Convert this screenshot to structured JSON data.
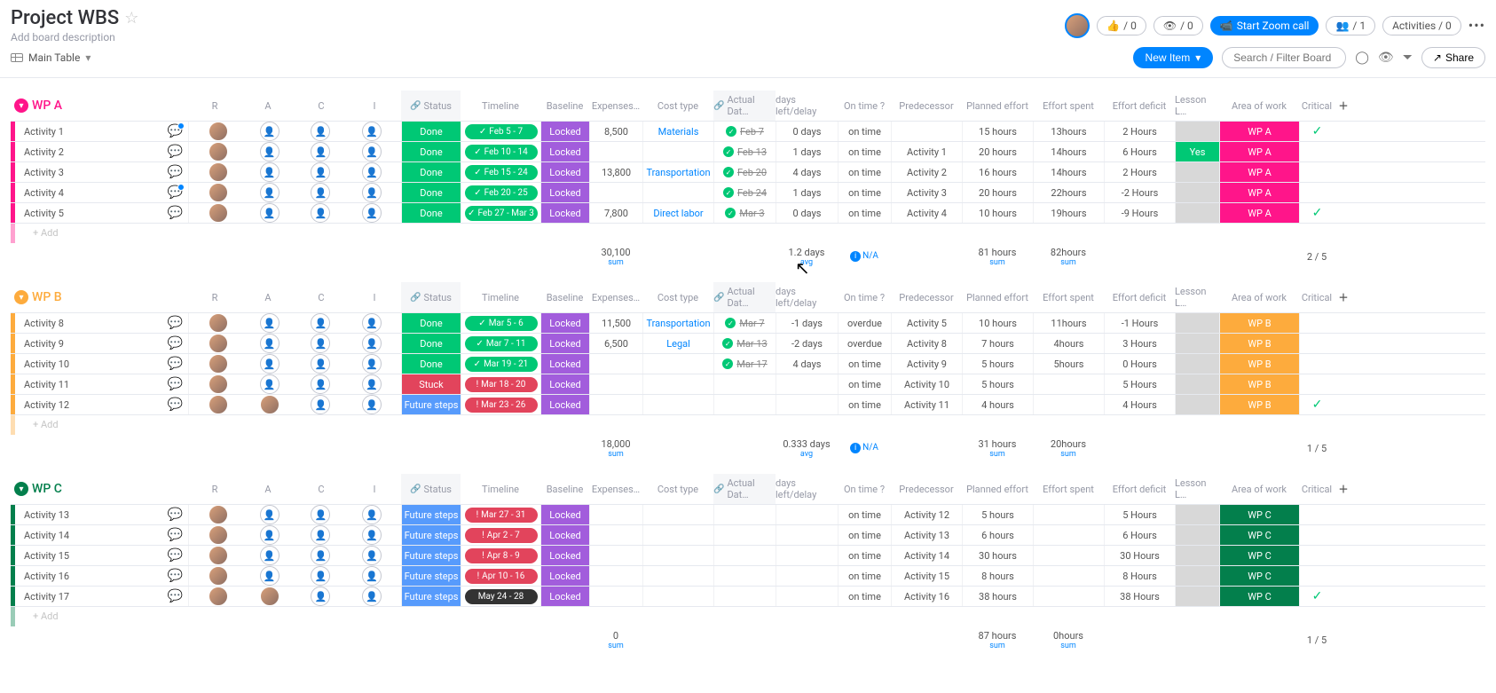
{
  "header": {
    "title": "Project WBS",
    "subtitle": "Add board description",
    "view_label": "Main Table",
    "like_count": "/ 0",
    "view_count": "/ 0",
    "zoom_label": "Start Zoom call",
    "people_count": "/ 1",
    "activities_label": "Activities / 0",
    "new_item_label": "New Item",
    "search_placeholder": "Search / Filter Board",
    "share_label": "Share"
  },
  "columns": {
    "r": "R",
    "a": "A",
    "c": "C",
    "i": "I",
    "status": "Status",
    "timeline": "Timeline",
    "baseline": "Baseline",
    "expenses": "Expenses…",
    "cost_type": "Cost type",
    "actual_date": "Actual Dat…",
    "days_left": "days left/delay",
    "on_time": "On time ?",
    "predecessor": "Predecessor",
    "planned_effort": "Planned effort",
    "effort_spent": "Effort spent",
    "effort_deficit": "Effort deficit",
    "lesson": "Lesson L…",
    "area": "Area of work",
    "critical": "Critical"
  },
  "groups": [
    {
      "id": "wpa",
      "title": "WP A",
      "color": "#ff158a",
      "rows": [
        {
          "name": "Activity 1",
          "chat": "active",
          "people": [
            true,
            false,
            false,
            false
          ],
          "status": "Done",
          "status_cls": "done",
          "timeline": "Feb 5 - 7",
          "tl_cls": "done",
          "tl_sym": "✓",
          "baseline": "Locked",
          "expenses": "8,500",
          "cost_type": "Materials",
          "actual": "Feb 7",
          "actual_done": true,
          "days": "0 days",
          "ontime": "on time",
          "pred": "",
          "planned": "15 hours",
          "spent": "13hours",
          "deficit": "2 Hours",
          "lesson": "",
          "lesson_bg": "grey",
          "area": "WP A",
          "area_bg": "pink",
          "critical": true
        },
        {
          "name": "Activity 2",
          "chat": "",
          "people": [
            true,
            false,
            false,
            false
          ],
          "status": "Done",
          "status_cls": "done",
          "timeline": "Feb 10 - 14",
          "tl_cls": "done",
          "tl_sym": "✓",
          "baseline": "Locked",
          "expenses": "",
          "cost_type": "",
          "actual": "Feb 13",
          "actual_done": true,
          "days": "1 days",
          "ontime": "on time",
          "pred": "Activity 1",
          "planned": "20 hours",
          "spent": "14hours",
          "deficit": "6 Hours",
          "lesson": "Yes",
          "lesson_bg": "green",
          "area": "WP A",
          "area_bg": "pink",
          "critical": false
        },
        {
          "name": "Activity 3",
          "chat": "",
          "people": [
            true,
            false,
            false,
            false
          ],
          "status": "Done",
          "status_cls": "done",
          "timeline": "Feb 15 - 24",
          "tl_cls": "done",
          "tl_sym": "✓",
          "baseline": "Locked",
          "expenses": "13,800",
          "cost_type": "Transportation",
          "actual": "Feb 20",
          "actual_done": true,
          "days": "4 days",
          "ontime": "on time",
          "pred": "Activity 2",
          "planned": "16 hours",
          "spent": "14hours",
          "deficit": "2 Hours",
          "lesson": "",
          "lesson_bg": "grey",
          "area": "WP A",
          "area_bg": "pink",
          "critical": false
        },
        {
          "name": "Activity 4",
          "chat": "active",
          "people": [
            true,
            false,
            false,
            false
          ],
          "status": "Done",
          "status_cls": "done",
          "timeline": "Feb 20 - 25",
          "tl_cls": "done",
          "tl_sym": "✓",
          "baseline": "Locked",
          "expenses": "",
          "cost_type": "",
          "actual": "Feb 24",
          "actual_done": true,
          "days": "1 days",
          "ontime": "on time",
          "pred": "Activity 3",
          "planned": "20 hours",
          "spent": "22hours",
          "deficit": "-2 Hours",
          "lesson": "",
          "lesson_bg": "grey",
          "area": "WP A",
          "area_bg": "pink",
          "critical": false
        },
        {
          "name": "Activity 5",
          "chat": "",
          "people": [
            true,
            false,
            false,
            false
          ],
          "status": "Done",
          "status_cls": "done",
          "timeline": "Feb 27 - Mar 3",
          "tl_cls": "done",
          "tl_sym": "✓",
          "baseline": "Locked",
          "expenses": "7,800",
          "cost_type": "Direct labor",
          "actual": "Mar 3",
          "actual_done": true,
          "days": "0 days",
          "ontime": "on time",
          "pred": "Activity 4",
          "planned": "10 hours",
          "spent": "19hours",
          "deficit": "-9 Hours",
          "lesson": "",
          "lesson_bg": "grey",
          "area": "WP A",
          "area_bg": "pink",
          "critical": true
        }
      ],
      "footer": {
        "expenses_sum": "30,100",
        "days_avg": "1.2 days",
        "ontime": "N/A",
        "planned": "81 hours",
        "spent": "82hours",
        "critical": "2 / 5"
      }
    },
    {
      "id": "wpb",
      "title": "WP B",
      "color": "#fdab3d",
      "rows": [
        {
          "name": "Activity 8",
          "chat": "",
          "people": [
            true,
            false,
            false,
            false
          ],
          "status": "Done",
          "status_cls": "done",
          "timeline": "Mar 5 - 6",
          "tl_cls": "done",
          "tl_sym": "✓",
          "baseline": "Locked",
          "expenses": "11,500",
          "cost_type": "Transportation",
          "actual": "Mar 7",
          "actual_done": true,
          "days": "-1 days",
          "ontime": "overdue",
          "pred": "Activity 5",
          "planned": "10 hours",
          "spent": "11hours",
          "deficit": "-1 Hours",
          "lesson": "",
          "lesson_bg": "grey",
          "area": "WP B",
          "area_bg": "amber",
          "critical": false
        },
        {
          "name": "Activity 9",
          "chat": "",
          "people": [
            true,
            false,
            false,
            false
          ],
          "status": "Done",
          "status_cls": "done",
          "timeline": "Mar 7 - 11",
          "tl_cls": "done",
          "tl_sym": "✓",
          "baseline": "Locked",
          "expenses": "6,500",
          "cost_type": "Legal",
          "actual": "Mar 13",
          "actual_done": true,
          "days": "-2 days",
          "ontime": "overdue",
          "pred": "Activity 8",
          "planned": "7 hours",
          "spent": "4hours",
          "deficit": "3 Hours",
          "lesson": "",
          "lesson_bg": "grey",
          "area": "WP B",
          "area_bg": "amber",
          "critical": false
        },
        {
          "name": "Activity 10",
          "chat": "",
          "people": [
            true,
            false,
            false,
            false
          ],
          "status": "Done",
          "status_cls": "done",
          "timeline": "Mar 19 - 21",
          "tl_cls": "done",
          "tl_sym": "✓",
          "baseline": "Locked",
          "expenses": "",
          "cost_type": "",
          "actual": "Mar 17",
          "actual_done": true,
          "days": "4 days",
          "ontime": "on time",
          "pred": "Activity 9",
          "planned": "5 hours",
          "spent": "5hours",
          "deficit": "0 Hours",
          "lesson": "",
          "lesson_bg": "grey",
          "area": "WP B",
          "area_bg": "amber",
          "critical": false
        },
        {
          "name": "Activity 11",
          "chat": "",
          "people": [
            true,
            false,
            false,
            false
          ],
          "status": "Stuck",
          "status_cls": "stuck",
          "timeline": "Mar 18 - 20",
          "tl_cls": "stuck",
          "tl_sym": "!",
          "baseline": "Locked",
          "expenses": "",
          "cost_type": "",
          "actual": "",
          "actual_done": false,
          "days": "",
          "ontime": "on time",
          "pred": "Activity 10",
          "planned": "5 hours",
          "spent": "",
          "deficit": "5 Hours",
          "lesson": "",
          "lesson_bg": "grey",
          "area": "WP B",
          "area_bg": "amber",
          "critical": false
        },
        {
          "name": "Activity 12",
          "chat": "",
          "people": [
            true,
            true,
            false,
            false
          ],
          "status": "Future steps",
          "status_cls": "future",
          "timeline": "Mar 23 - 26",
          "tl_cls": "stuck",
          "tl_sym": "!",
          "baseline": "Locked",
          "expenses": "",
          "cost_type": "",
          "actual": "",
          "actual_done": false,
          "days": "",
          "ontime": "on time",
          "pred": "Activity 11",
          "planned": "4 hours",
          "spent": "",
          "deficit": "4 Hours",
          "lesson": "",
          "lesson_bg": "grey",
          "area": "WP B",
          "area_bg": "amber",
          "critical": true
        }
      ],
      "footer": {
        "expenses_sum": "18,000",
        "days_avg": "0.333 days",
        "ontime": "N/A",
        "planned": "31 hours",
        "spent": "20hours",
        "critical": "1 / 5"
      }
    },
    {
      "id": "wpc",
      "title": "WP C",
      "color": "#037f4c",
      "rows": [
        {
          "name": "Activity 13",
          "chat": "",
          "people": [
            true,
            false,
            false,
            false
          ],
          "status": "Future steps",
          "status_cls": "future",
          "timeline": "Mar 27 - 31",
          "tl_cls": "stuck",
          "tl_sym": "!",
          "baseline": "Locked",
          "expenses": "",
          "cost_type": "",
          "actual": "",
          "actual_done": false,
          "days": "",
          "ontime": "on time",
          "pred": "Activity 12",
          "planned": "5 hours",
          "spent": "",
          "deficit": "5 Hours",
          "lesson": "",
          "lesson_bg": "grey",
          "area": "WP C",
          "area_bg": "darkgreen",
          "critical": false
        },
        {
          "name": "Activity 14",
          "chat": "",
          "people": [
            true,
            false,
            false,
            false
          ],
          "status": "Future steps",
          "status_cls": "future",
          "timeline": "Apr 2 - 7",
          "tl_cls": "stuck",
          "tl_sym": "!",
          "baseline": "Locked",
          "expenses": "",
          "cost_type": "",
          "actual": "",
          "actual_done": false,
          "days": "",
          "ontime": "on time",
          "pred": "Activity 13",
          "planned": "6 hours",
          "spent": "",
          "deficit": "6 Hours",
          "lesson": "",
          "lesson_bg": "grey",
          "area": "WP C",
          "area_bg": "darkgreen",
          "critical": false
        },
        {
          "name": "Activity 15",
          "chat": "",
          "people": [
            true,
            false,
            false,
            false
          ],
          "status": "Future steps",
          "status_cls": "future",
          "timeline": "Apr 8 - 9",
          "tl_cls": "stuck",
          "tl_sym": "!",
          "baseline": "Locked",
          "expenses": "",
          "cost_type": "",
          "actual": "",
          "actual_done": false,
          "days": "",
          "ontime": "on time",
          "pred": "Activity 14",
          "planned": "30 hours",
          "spent": "",
          "deficit": "30 Hours",
          "lesson": "",
          "lesson_bg": "grey",
          "area": "WP C",
          "area_bg": "darkgreen",
          "critical": false
        },
        {
          "name": "Activity 16",
          "chat": "",
          "people": [
            true,
            false,
            false,
            false
          ],
          "status": "Future steps",
          "status_cls": "future",
          "timeline": "Apr 10 - 16",
          "tl_cls": "stuck",
          "tl_sym": "!",
          "baseline": "Locked",
          "expenses": "",
          "cost_type": "",
          "actual": "",
          "actual_done": false,
          "days": "",
          "ontime": "on time",
          "pred": "Activity 15",
          "planned": "8 hours",
          "spent": "",
          "deficit": "8 Hours",
          "lesson": "",
          "lesson_bg": "grey",
          "area": "WP C",
          "area_bg": "darkgreen",
          "critical": false
        },
        {
          "name": "Activity 17",
          "chat": "",
          "people": [
            true,
            true,
            false,
            false
          ],
          "status": "Future steps",
          "status_cls": "future",
          "timeline": "May 24 - 28",
          "tl_cls": "future",
          "tl_sym": "",
          "baseline": "Locked",
          "expenses": "",
          "cost_type": "",
          "actual": "",
          "actual_done": false,
          "days": "",
          "ontime": "on time",
          "pred": "Activity 16",
          "planned": "38 hours",
          "spent": "",
          "deficit": "38 Hours",
          "lesson": "",
          "lesson_bg": "grey",
          "area": "WP C",
          "area_bg": "darkgreen",
          "critical": true
        }
      ],
      "footer": {
        "expenses_sum": "0",
        "days_avg": "",
        "ontime": "",
        "planned": "87 hours",
        "spent": "0hours",
        "critical": "1 / 5"
      }
    }
  ],
  "misc": {
    "add_label": "+ Add",
    "sum_label": "sum",
    "avg_label": "avg"
  }
}
